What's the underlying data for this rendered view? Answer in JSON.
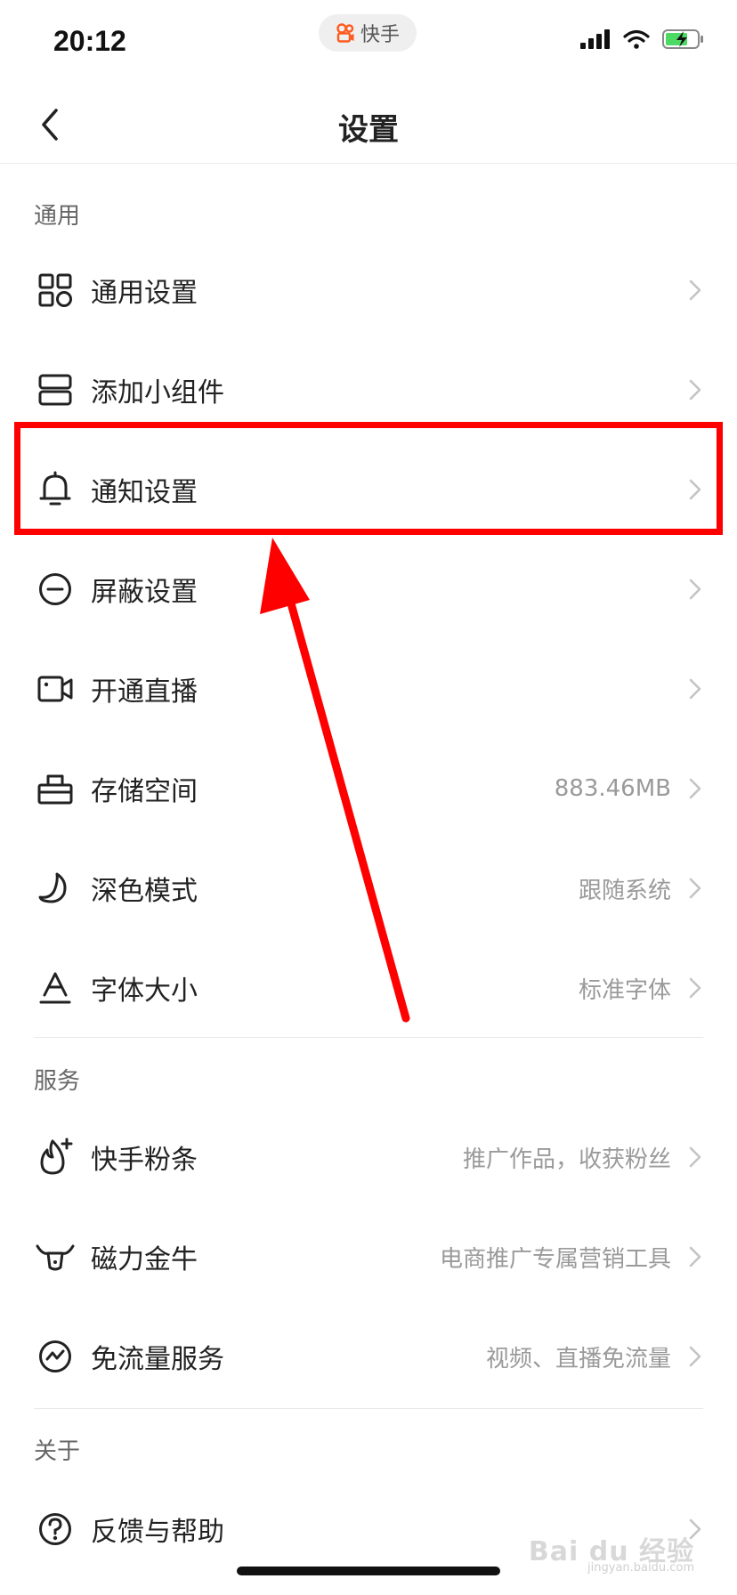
{
  "status_bar": {
    "time": "20:12",
    "app_pill": "快手"
  },
  "header": {
    "title": "设置"
  },
  "sections": [
    {
      "title": "通用",
      "items": [
        {
          "icon": "grid-icon",
          "label": "通用设置",
          "value": ""
        },
        {
          "icon": "widget-icon",
          "label": "添加小组件",
          "value": ""
        },
        {
          "icon": "bell-icon",
          "label": "通知设置",
          "value": ""
        },
        {
          "icon": "block-icon",
          "label": "屏蔽设置",
          "value": ""
        },
        {
          "icon": "video-camera-icon",
          "label": "开通直播",
          "value": ""
        },
        {
          "icon": "storage-box-icon",
          "label": "存储空间",
          "value": "883.46MB"
        },
        {
          "icon": "moon-icon",
          "label": "深色模式",
          "value": "跟随系统"
        },
        {
          "icon": "font-size-icon",
          "label": "字体大小",
          "value": "标准字体"
        }
      ]
    },
    {
      "title": "服务",
      "items": [
        {
          "icon": "fire-plus-icon",
          "label": "快手粉条",
          "value": "推广作品，收获粉丝"
        },
        {
          "icon": "bull-icon",
          "label": "磁力金牛",
          "value": "电商推广专属营销工具"
        },
        {
          "icon": "free-data-icon",
          "label": "免流量服务",
          "value": "视频、直播免流量"
        }
      ]
    },
    {
      "title": "关于",
      "items": [
        {
          "icon": "help-icon",
          "label": "反馈与帮助",
          "value": ""
        }
      ]
    }
  ],
  "watermark": {
    "main": "Bai du 经验",
    "sub": "jingyan.baidu.com"
  },
  "colors": {
    "annotation": "#ff0000",
    "value_text": "#9a9a9a",
    "chevron": "#c4c4c4"
  }
}
